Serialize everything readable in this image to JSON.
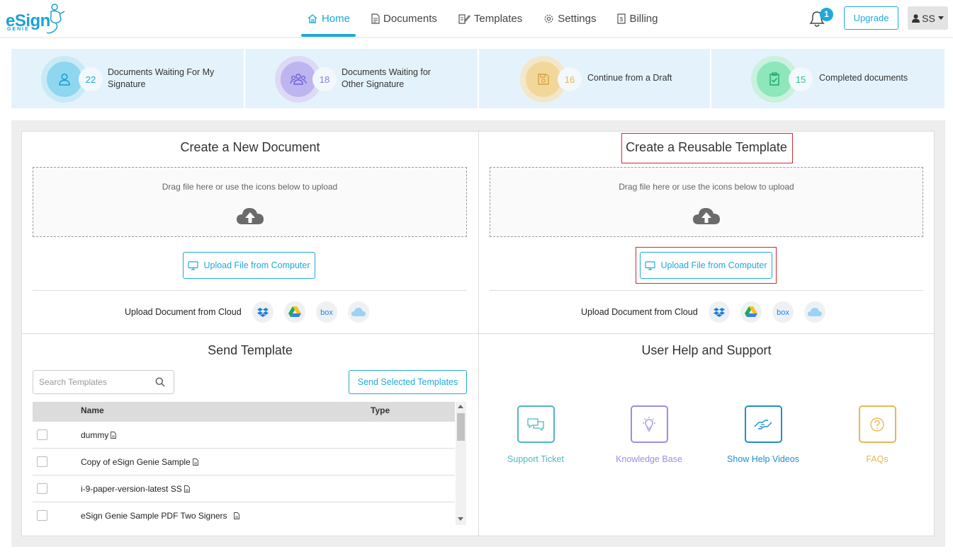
{
  "brand": {
    "logo_text": "eSign",
    "logo_sub": "GENIE"
  },
  "nav": {
    "items": [
      {
        "label": "Home",
        "icon": "home-icon",
        "active": true
      },
      {
        "label": "Documents",
        "icon": "document-icon",
        "active": false
      },
      {
        "label": "Templates",
        "icon": "template-icon",
        "active": false
      },
      {
        "label": "Settings",
        "icon": "gear-icon",
        "active": false
      },
      {
        "label": "Billing",
        "icon": "billing-icon",
        "active": false
      }
    ]
  },
  "header": {
    "notification_count": "1",
    "upgrade_label": "Upgrade",
    "user_initials": "SS"
  },
  "stats": [
    {
      "count": "22",
      "label_line1": "Documents Waiting For My",
      "label_line2": "Signature",
      "color": "#20a8db",
      "icon": "user-icon"
    },
    {
      "count": "18",
      "label_line1": "Documents Waiting for",
      "label_line2": "Other Signature",
      "color": "#8a7fe0",
      "icon": "users-icon"
    },
    {
      "count": "16",
      "label_line1": "Continue from a Draft",
      "label_line2": "",
      "color": "#e8b855",
      "icon": "save-icon"
    },
    {
      "count": "15",
      "label_line1": "Completed documents",
      "label_line2": "",
      "color": "#2ec58b",
      "icon": "clipboard-check-icon"
    }
  ],
  "create_document": {
    "title": "Create a New Document",
    "drop_text": "Drag file here or use the icons below to upload",
    "upload_button": "Upload File from Computer",
    "cloud_label": "Upload Document from Cloud",
    "cloud_services": [
      "dropbox-icon",
      "google-drive-icon",
      "box-icon",
      "onedrive-icon"
    ]
  },
  "create_template": {
    "title": "Create a Reusable Template",
    "drop_text": "Drag file here or use the icons below to upload",
    "upload_button": "Upload File from Computer",
    "cloud_label": "Upload Document from Cloud",
    "cloud_services": [
      "dropbox-icon",
      "google-drive-icon",
      "box-icon",
      "onedrive-icon"
    ]
  },
  "send_template": {
    "title": "Send Template",
    "search_placeholder": "Search Templates",
    "send_button": "Send Selected Templates",
    "columns": [
      "Name",
      "Type"
    ],
    "rows": [
      {
        "name": "dummy"
      },
      {
        "name": "Copy of eSign Genie Sample"
      },
      {
        "name": "i-9-paper-version-latest SS"
      },
      {
        "name": "eSign Genie Sample PDF Two Signers"
      }
    ]
  },
  "help": {
    "title": "User Help and Support",
    "items": [
      {
        "label": "Support Ticket",
        "icon": "chat-icon",
        "color": "#4fb8bf"
      },
      {
        "label": "Knowledge Base",
        "icon": "lightbulb-icon",
        "color": "#9a8ee6"
      },
      {
        "label": "Show Help Videos",
        "icon": "handshake-icon",
        "color": "#1f8fc9"
      },
      {
        "label": "FAQs",
        "icon": "question-icon",
        "color": "#e8b855"
      }
    ]
  }
}
